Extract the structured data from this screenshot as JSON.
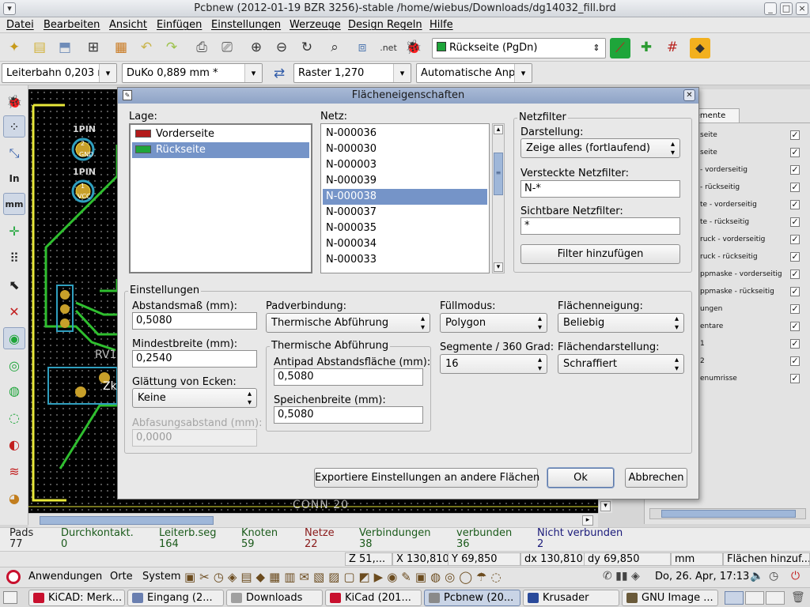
{
  "window": {
    "title": "Pcbnew (2012-01-19 BZR 3256)-stable /home/wiebus/Downloads/dg14032_fill.brd"
  },
  "menubar": [
    "Datei",
    "Bearbeiten",
    "Ansicht",
    "Einfügen",
    "Einstellungen",
    "Werzeuge",
    "Design Regeln",
    "Hilfe"
  ],
  "toolbar1": {
    "layer_select": "Rückseite (PgDn)",
    "net_label": ".net"
  },
  "toolbar2": {
    "track_width": "Leiterbahn 0,203 r",
    "via_size": "DuKo 0,889 mm *",
    "grid": "Raster 1,270",
    "zoom": "Automatische Anp"
  },
  "canvas": {
    "labels": [
      "1PIN",
      "GND",
      "2",
      "1PIN",
      "VCC",
      "1",
      "RV1",
      "CONN 20",
      "Zk"
    ]
  },
  "right_panel": {
    "tab_label": "lemente",
    "items": [
      "seite",
      "seite",
      "- vorderseitig",
      "- rückseitig",
      "te - vorderseitig",
      "te - rückseitig",
      "ruck - vorderseitig",
      "ruck - rückseitig",
      "ppmaske - vorderseitig",
      "ppmaske - rückseitig",
      "ungen",
      "entare",
      "1",
      "2",
      "enumrisse"
    ]
  },
  "dialog": {
    "title": "Flächeneigenschaften",
    "lage_label": "Lage:",
    "layers": [
      {
        "name": "Vorderseite",
        "color": "#b31b1b"
      },
      {
        "name": "Rückseite",
        "color": "#1ea53a"
      }
    ],
    "netz_label": "Netz:",
    "nets": [
      "N-000036",
      "N-000030",
      "N-000003",
      "N-000039",
      "N-000038",
      "N-000037",
      "N-000035",
      "N-000034",
      "N-000033"
    ],
    "selected_net": "N-000038",
    "netfilter": {
      "label": "Netzfilter",
      "display_label": "Darstellung:",
      "display_value": "Zeige alles (fortlaufend)",
      "hidden_label": "Versteckte Netzfilter:",
      "hidden_value": "N-*",
      "visible_label": "Sichtbare Netzfilter:",
      "visible_value": "*",
      "add_filter": "Filter hinzufügen"
    },
    "settings": {
      "label": "Einstellungen",
      "clearance_label": "Abstandsmaß (mm):",
      "clearance_value": "0,5080",
      "minwidth_label": "Mindestbreite (mm):",
      "minwidth_value": "0,2540",
      "smoothing_label": "Glättung von Ecken:",
      "smoothing_value": "Keine",
      "chamfer_label": "Abfasungsabstand (mm):",
      "chamfer_value": "0,0000",
      "padconn_label": "Padverbindung:",
      "padconn_value": "Thermische Abführung",
      "thermal_label": "Thermische Abführung",
      "antipad_label": "Antipad Abstandsfläche (mm):",
      "antipad_value": "0,5080",
      "spoke_label": "Speichenbreite (mm):",
      "spoke_value": "0,5080",
      "fillmode_label": "Füllmodus:",
      "fillmode_value": "Polygon",
      "segments_label": "Segmente / 360 Grad:",
      "segments_value": "16",
      "orientation_label": "Flächenneigung:",
      "orientation_value": "Beliebig",
      "outline_label": "Flächendarstellung:",
      "outline_value": "Schraffiert"
    },
    "buttons": {
      "export": "Exportiere Einstellungen an andere Flächen",
      "ok": "Ok",
      "cancel": "Abbrechen"
    }
  },
  "status": {
    "cols": [
      {
        "label": "Pads",
        "value": "77",
        "color": "#222222"
      },
      {
        "label": "Durchkontakt.",
        "value": "0",
        "color": "#1a5a1a"
      },
      {
        "label": "Leiterb.seg",
        "value": "164",
        "color": "#1a5a1a"
      },
      {
        "label": "Knoten",
        "value": "59",
        "color": "#1a5a1a"
      },
      {
        "label": "Netze",
        "value": "22",
        "color": "#8a1a1a"
      },
      {
        "label": "Verbindungen",
        "value": "38",
        "color": "#1a5a1a"
      },
      {
        "label": "verbunden",
        "value": "36",
        "color": "#1a5a1a"
      },
      {
        "label": "Nicht verbunden",
        "value": "2",
        "color": "#1a1a7a"
      }
    ],
    "zoom": "Z 51,...",
    "x": "X 130,810",
    "y": "Y 69,850",
    "dx": "dx 130,810",
    "dy": "dy 69,850",
    "units": "mm",
    "message": "Flächen hinzuf..."
  },
  "panel": {
    "apps": "Anwendungen",
    "places": "Orte",
    "system": "System",
    "clock": "Do, 26. Apr, 17:13"
  },
  "taskbar": [
    {
      "label": "KiCAD: Merk...",
      "active": false
    },
    {
      "label": "Eingang (2...",
      "active": false
    },
    {
      "label": "Downloads",
      "active": false
    },
    {
      "label": "KiCad (201...",
      "active": false
    },
    {
      "label": "Pcbnew (20...",
      "active": true
    },
    {
      "label": "Krusader",
      "active": false
    },
    {
      "label": "GNU Image ...",
      "active": false
    }
  ]
}
